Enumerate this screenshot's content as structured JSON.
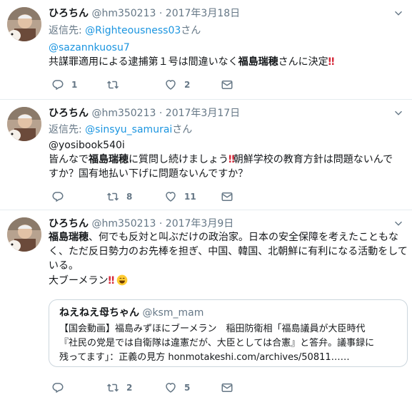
{
  "tweets": [
    {
      "name": "ひろちん",
      "handle": "@hm350213",
      "sep": "·",
      "date": "2017年3月18日",
      "reply_prefix": "返信先:",
      "reply_to": "@Righteousness03",
      "reply_suffix": "さん",
      "lines": {
        "l1": "@sazannkuosu7",
        "l2a": "共謀罪適用による逮捕第１号は間違いなく",
        "l2b": "福島瑞穂",
        "l2c": "さんに決定",
        "l2d": "‼"
      },
      "replies": "1",
      "retweets": "",
      "likes": "2"
    },
    {
      "name": "ひろちん",
      "handle": "@hm350213",
      "sep": "·",
      "date": "2017年3月17日",
      "reply_prefix": "返信先:",
      "reply_to": "@sinsyu_samurai",
      "reply_suffix": "さん",
      "lines": {
        "l1": "@yosibook540i",
        "l2a": "皆んなで",
        "l2b": "福島瑞穂",
        "l2c": "に質問し続けましょう",
        "l2d": "‼",
        "l2e": "朝鮮学校の教育方針は問題ないんで",
        "l3": "すか？国有地払い下げに問題ないんですか？"
      },
      "replies": "",
      "retweets": "8",
      "likes": "11"
    },
    {
      "name": "ひろちん",
      "handle": "@hm350213",
      "sep": "·",
      "date": "2017年3月9日",
      "lines": {
        "l1a": "福島瑞穂",
        "l1b": "、何でも反対と叫ぶだけの政治家。日本の安全保障を考えたこともな",
        "l2": "く、ただ反日勢力のお先棒を担ぎ、中国、韓国、北朝鮮に有利になる活動をして",
        "l3": "いる。",
        "l4a": "大ブーメラン",
        "l4b": "‼"
      },
      "quote": {
        "name": "ねえねえ母ちゃん",
        "handle": "@ksm_mam",
        "line1": "【国会動画】福島みずほにブーメラン　稲田防衛相「福島議員が大臣時代",
        "line2": "『社民の党是では自衛隊は違憲だが、大臣としては合憲』と答弁。議事録に",
        "line3": "残ってます」：正義の見方 honmotakeshi.com/archives/50811……"
      },
      "replies": "",
      "retweets": "2",
      "likes": "5"
    }
  ],
  "icons": {
    "reply": "reply-icon",
    "retweet": "retweet-icon",
    "like": "heart-icon",
    "dm": "envelope-icon",
    "more": "chevron-down-icon"
  },
  "colors": {
    "link": "#1b95e0",
    "muted": "#657786",
    "border": "#e6ecf0",
    "bangs": "#d62839"
  }
}
